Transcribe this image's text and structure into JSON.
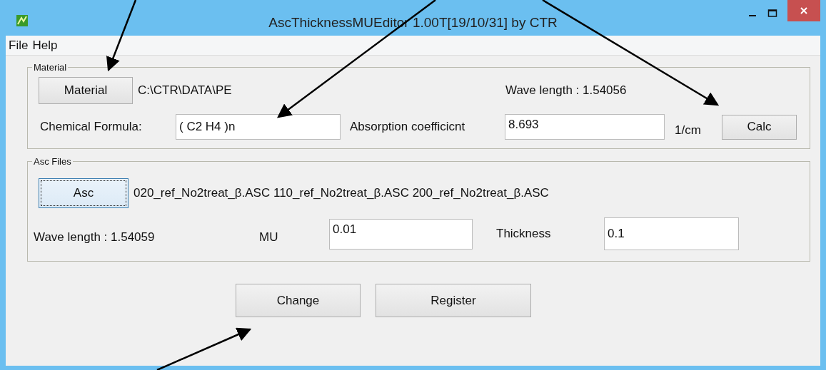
{
  "window": {
    "title": "AscThicknessMUEditor 1.00T[19/10/31] by CTR"
  },
  "menu": [
    "File",
    "Help"
  ],
  "material": {
    "legend": "Material",
    "button": {
      "label": "Material",
      "focused": false
    },
    "path": "C:\\CTR\\DATA\\PE",
    "wave_length": "Wave length : 1.54056",
    "formula_label": "Chemical Formula:",
    "formula": "( C2 H4 )n",
    "absorption_label": "Absorption coefficicnt",
    "absorption": "8.693",
    "unit": "1/cm",
    "calc_button": {
      "label": "Calc",
      "focused": false
    }
  },
  "asc_files": {
    "legend": "Asc Files",
    "button": {
      "label": "Asc",
      "focused": true
    },
    "files": "020_ref_No2treat_β.ASC 110_ref_No2treat_β.ASC 200_ref_No2treat_β.ASC",
    "wave_length": "Wave length : 1.54059",
    "mu_label": "MU",
    "mu": "0.01",
    "thickness_label": "Thickness",
    "thickness": "0.1"
  },
  "buttons": [
    {
      "label": "Change",
      "focused": false
    },
    {
      "label": "Register",
      "focused": false
    }
  ]
}
